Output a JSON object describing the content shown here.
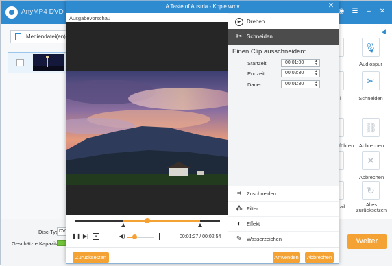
{
  "background_app": {
    "title": "AnyMP4 DVD Cre",
    "add_media_label": "Mediendatei(en) hi",
    "disc_type_label": "Disc-Typ",
    "disc_type_value": "DVD",
    "capacity_label": "Geschätzte Kapazität:",
    "next_label": "Weiter",
    "right_labels": {
      "audio_track": "Audiospur",
      "cut": "Schneiden",
      "partial_left_1": "l",
      "merge_partial": "führen",
      "cancel": "Abbrechen",
      "partial_left_2": "ail",
      "reset_all_line1": "Alles",
      "reset_all_line2": "zurücksetzen"
    }
  },
  "dialog": {
    "title": "A Taste of Austria - Kopie.wmv",
    "preview_label": "Ausgabevorschau",
    "tabs": {
      "rotate": "Drehen",
      "cut": "Schneiden"
    },
    "clip": {
      "heading": "Einen Clip ausschneiden:",
      "start_label": "Startzeit:",
      "start_value": "00:01:00",
      "end_label": "Endzeit:",
      "end_value": "00:02:30",
      "duration_label": "Dauer:",
      "duration_value": "00:01:30"
    },
    "tools": {
      "crop": "Zuschneiden",
      "filter": "Filter",
      "effect": "Effekt",
      "watermark": "Wasserzeichen"
    },
    "player": {
      "current_time": "00:01:27",
      "separator": "/",
      "total_time": "00:02:54",
      "progress_fraction": 0.5,
      "volume_fraction": 0.25
    },
    "buttons": {
      "reset": "Zurücksetzen",
      "apply": "Anwenden",
      "cancel": "Abbrechen"
    }
  },
  "colors": {
    "titlebar_blue": "#2f8bd0",
    "accent_orange": "#f3a233",
    "tab_selected": "#4c4c4c",
    "capacity_green": "#74c43b"
  }
}
